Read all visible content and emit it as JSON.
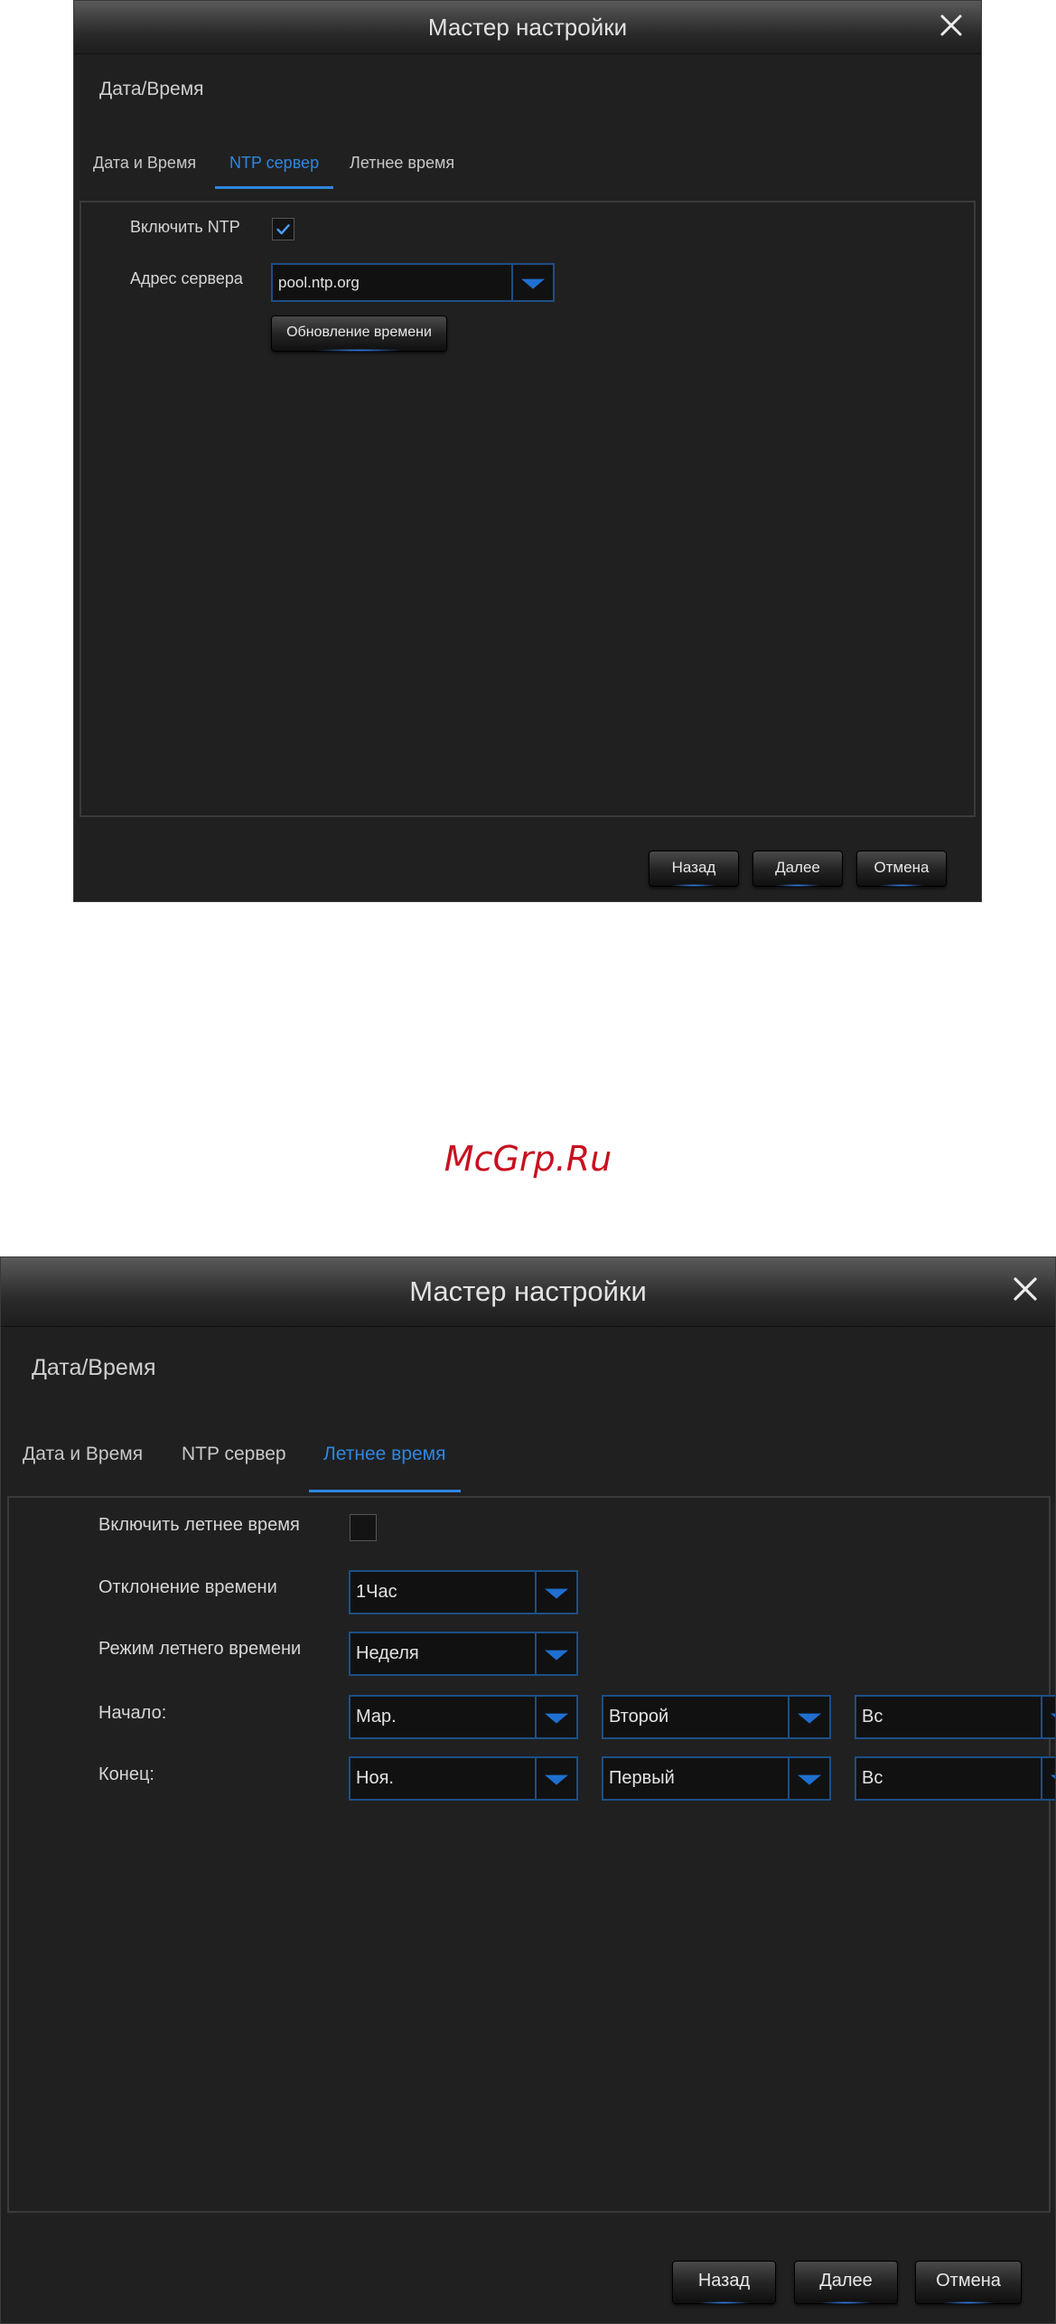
{
  "watermark": "McGrp.Ru",
  "colors": {
    "accent": "#2f86e0",
    "panel_bg": "#202020",
    "select_border": "#1c4f86"
  },
  "dialog1": {
    "title": "Мастер настройки",
    "close_icon": "close-icon",
    "section_title": "Дата/Время",
    "tabs": [
      {
        "label": "Дата и Время",
        "active": false
      },
      {
        "label": "NTP сервер",
        "active": true
      },
      {
        "label": "Летнее время",
        "active": false
      }
    ],
    "enable_ntp": {
      "label": "Включить NTP",
      "checked": true
    },
    "server_address": {
      "label": "Адрес сервера",
      "value": "pool.ntp.org"
    },
    "update_time_button": "Обновление времени",
    "buttons": {
      "back": "Назад",
      "next": "Далее",
      "cancel": "Отмена"
    }
  },
  "dialog2": {
    "title": "Мастер настройки",
    "close_icon": "close-icon",
    "section_title": "Дата/Время",
    "tabs": [
      {
        "label": "Дата и Время",
        "active": false
      },
      {
        "label": "NTP сервер",
        "active": false
      },
      {
        "label": "Летнее время",
        "active": true
      }
    ],
    "enable_dst": {
      "label": "Включить летнее время",
      "checked": false
    },
    "time_offset": {
      "label": "Отклонение времени",
      "value": "1Час"
    },
    "dst_mode": {
      "label": "Режим летнего времени",
      "value": "Неделя"
    },
    "start": {
      "label": "Начало:",
      "month": "Мар.",
      "week": "Второй",
      "day": "Вс"
    },
    "end": {
      "label": "Конец:",
      "month": "Ноя.",
      "week": "Первый",
      "day": "Вс"
    },
    "buttons": {
      "back": "Назад",
      "next": "Далее",
      "cancel": "Отмена"
    }
  }
}
